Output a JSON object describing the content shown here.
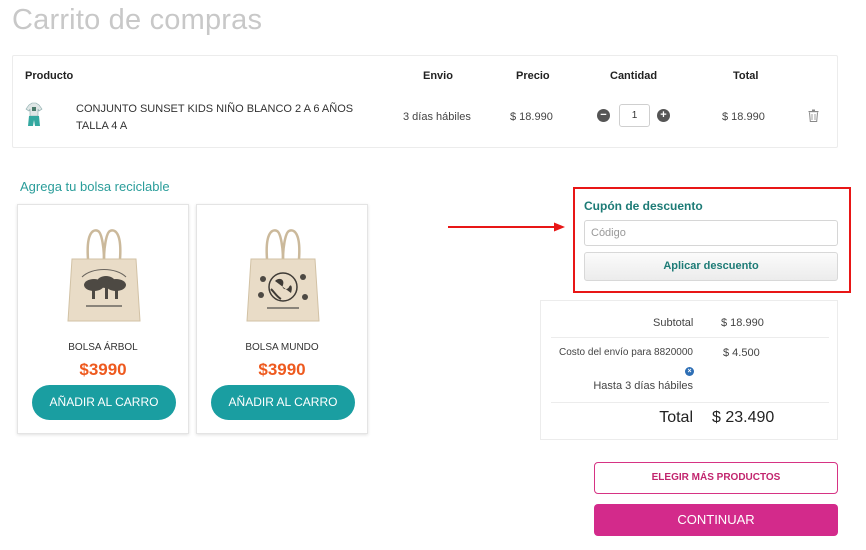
{
  "page": {
    "title": "Carrito de compras"
  },
  "cart": {
    "headers": {
      "product": "Producto",
      "shipping": "Envio",
      "price": "Precio",
      "quantity": "Cantidad",
      "total": "Total"
    },
    "items": [
      {
        "name": "CONJUNTO SUNSET KIDS NIÑO BLANCO 2 A 6 AÑOS TALLA 4 A",
        "shipping": "3 días hábiles",
        "price": "$ 18.990",
        "quantity": "1",
        "total": "$ 18.990"
      }
    ]
  },
  "bags": {
    "title": "Agrega tu bolsa reciclable",
    "items": [
      {
        "name": "BOLSA ÁRBOL",
        "price": "$3990",
        "button": "AÑADIR AL CARRO"
      },
      {
        "name": "BOLSA MUNDO",
        "price": "$3990",
        "button": "AÑADIR AL CARRO"
      }
    ]
  },
  "coupon": {
    "title": "Cupón de descuento",
    "placeholder": "Código",
    "button": "Aplicar descuento"
  },
  "summary": {
    "subtotal_label": "Subtotal",
    "subtotal_value": "$ 18.990",
    "shipping_label": "Costo del envío para 8820000",
    "shipping_value": "$ 4.500",
    "shipping_time": "Hasta 3 días hábiles",
    "total_label": "Total",
    "total_value": "$ 23.490"
  },
  "actions": {
    "more_products": "ELEGIR MÁS PRODUCTOS",
    "continue": "CONTINUAR"
  },
  "icons": {
    "minus": "minus-circle-icon",
    "plus": "plus-circle-icon",
    "trash": "trash-icon",
    "remove_shipping": "close-circle-icon",
    "arrow": "arrow-right-icon"
  },
  "colors": {
    "accent_teal": "#1a9ea1",
    "price_orange": "#ee5a1f",
    "primary_pink": "#d32a8b",
    "highlight_red": "#e81616"
  }
}
